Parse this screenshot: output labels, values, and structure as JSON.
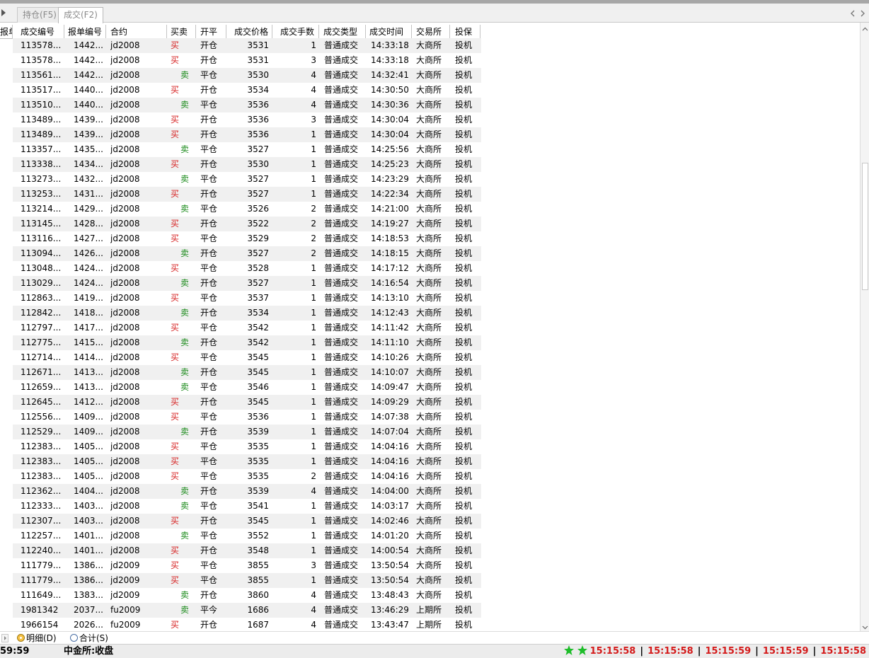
{
  "tabs": [
    {
      "label": "持仓(F5)"
    },
    {
      "label": "成交(F2)"
    }
  ],
  "columns": {
    "left_partial": "报单",
    "trade_id": "成交编号",
    "order_id": "报单编号",
    "instrument": "合约",
    "buy_sell": "买卖",
    "open_close": "开平",
    "price": "成交价格",
    "quantity": "成交手数",
    "trade_type": "成交类型",
    "trade_time": "成交时间",
    "exchange": "交易所",
    "hedge": "投保"
  },
  "rows": [
    {
      "trade_id": "113578...",
      "order_id": "1442...",
      "instrument": "jd2008",
      "side": "buy",
      "buy_sell": "买",
      "open_close": "开仓",
      "price": "3531",
      "quantity": "1",
      "trade_type": "普通成交",
      "trade_time": "14:33:18",
      "exchange": "大商所",
      "hedge": "投机"
    },
    {
      "trade_id": "113578...",
      "order_id": "1442...",
      "instrument": "jd2008",
      "side": "buy",
      "buy_sell": "买",
      "open_close": "开仓",
      "price": "3531",
      "quantity": "3",
      "trade_type": "普通成交",
      "trade_time": "14:33:18",
      "exchange": "大商所",
      "hedge": "投机"
    },
    {
      "trade_id": "113561...",
      "order_id": "1442...",
      "instrument": "jd2008",
      "side": "sell",
      "buy_sell": "卖",
      "open_close": "平仓",
      "price": "3530",
      "quantity": "4",
      "trade_type": "普通成交",
      "trade_time": "14:32:41",
      "exchange": "大商所",
      "hedge": "投机"
    },
    {
      "trade_id": "113517...",
      "order_id": "1440...",
      "instrument": "jd2008",
      "side": "buy",
      "buy_sell": "买",
      "open_close": "开仓",
      "price": "3534",
      "quantity": "4",
      "trade_type": "普通成交",
      "trade_time": "14:30:50",
      "exchange": "大商所",
      "hedge": "投机"
    },
    {
      "trade_id": "113510...",
      "order_id": "1440...",
      "instrument": "jd2008",
      "side": "sell",
      "buy_sell": "卖",
      "open_close": "平仓",
      "price": "3536",
      "quantity": "4",
      "trade_type": "普通成交",
      "trade_time": "14:30:36",
      "exchange": "大商所",
      "hedge": "投机"
    },
    {
      "trade_id": "113489...",
      "order_id": "1439...",
      "instrument": "jd2008",
      "side": "buy",
      "buy_sell": "买",
      "open_close": "开仓",
      "price": "3536",
      "quantity": "3",
      "trade_type": "普通成交",
      "trade_time": "14:30:04",
      "exchange": "大商所",
      "hedge": "投机"
    },
    {
      "trade_id": "113489...",
      "order_id": "1439...",
      "instrument": "jd2008",
      "side": "buy",
      "buy_sell": "买",
      "open_close": "开仓",
      "price": "3536",
      "quantity": "1",
      "trade_type": "普通成交",
      "trade_time": "14:30:04",
      "exchange": "大商所",
      "hedge": "投机"
    },
    {
      "trade_id": "113357...",
      "order_id": "1435...",
      "instrument": "jd2008",
      "side": "sell",
      "buy_sell": "卖",
      "open_close": "平仓",
      "price": "3527",
      "quantity": "1",
      "trade_type": "普通成交",
      "trade_time": "14:25:56",
      "exchange": "大商所",
      "hedge": "投机"
    },
    {
      "trade_id": "113338...",
      "order_id": "1434...",
      "instrument": "jd2008",
      "side": "buy",
      "buy_sell": "买",
      "open_close": "开仓",
      "price": "3530",
      "quantity": "1",
      "trade_type": "普通成交",
      "trade_time": "14:25:23",
      "exchange": "大商所",
      "hedge": "投机"
    },
    {
      "trade_id": "113273...",
      "order_id": "1432...",
      "instrument": "jd2008",
      "side": "sell",
      "buy_sell": "卖",
      "open_close": "平仓",
      "price": "3527",
      "quantity": "1",
      "trade_type": "普通成交",
      "trade_time": "14:23:29",
      "exchange": "大商所",
      "hedge": "投机"
    },
    {
      "trade_id": "113253...",
      "order_id": "1431...",
      "instrument": "jd2008",
      "side": "buy",
      "buy_sell": "买",
      "open_close": "开仓",
      "price": "3527",
      "quantity": "1",
      "trade_type": "普通成交",
      "trade_time": "14:22:34",
      "exchange": "大商所",
      "hedge": "投机"
    },
    {
      "trade_id": "113214...",
      "order_id": "1429...",
      "instrument": "jd2008",
      "side": "sell",
      "buy_sell": "卖",
      "open_close": "平仓",
      "price": "3526",
      "quantity": "2",
      "trade_type": "普通成交",
      "trade_time": "14:21:00",
      "exchange": "大商所",
      "hedge": "投机"
    },
    {
      "trade_id": "113145...",
      "order_id": "1428...",
      "instrument": "jd2008",
      "side": "buy",
      "buy_sell": "买",
      "open_close": "开仓",
      "price": "3522",
      "quantity": "2",
      "trade_type": "普通成交",
      "trade_time": "14:19:27",
      "exchange": "大商所",
      "hedge": "投机"
    },
    {
      "trade_id": "113116...",
      "order_id": "1427...",
      "instrument": "jd2008",
      "side": "buy",
      "buy_sell": "买",
      "open_close": "平仓",
      "price": "3529",
      "quantity": "2",
      "trade_type": "普通成交",
      "trade_time": "14:18:53",
      "exchange": "大商所",
      "hedge": "投机"
    },
    {
      "trade_id": "113094...",
      "order_id": "1426...",
      "instrument": "jd2008",
      "side": "sell",
      "buy_sell": "卖",
      "open_close": "开仓",
      "price": "3527",
      "quantity": "2",
      "trade_type": "普通成交",
      "trade_time": "14:18:15",
      "exchange": "大商所",
      "hedge": "投机"
    },
    {
      "trade_id": "113048...",
      "order_id": "1424...",
      "instrument": "jd2008",
      "side": "buy",
      "buy_sell": "买",
      "open_close": "平仓",
      "price": "3528",
      "quantity": "1",
      "trade_type": "普通成交",
      "trade_time": "14:17:12",
      "exchange": "大商所",
      "hedge": "投机"
    },
    {
      "trade_id": "113029...",
      "order_id": "1424...",
      "instrument": "jd2008",
      "side": "sell",
      "buy_sell": "卖",
      "open_close": "开仓",
      "price": "3527",
      "quantity": "1",
      "trade_type": "普通成交",
      "trade_time": "14:16:54",
      "exchange": "大商所",
      "hedge": "投机"
    },
    {
      "trade_id": "112863...",
      "order_id": "1419...",
      "instrument": "jd2008",
      "side": "buy",
      "buy_sell": "买",
      "open_close": "平仓",
      "price": "3537",
      "quantity": "1",
      "trade_type": "普通成交",
      "trade_time": "14:13:10",
      "exchange": "大商所",
      "hedge": "投机"
    },
    {
      "trade_id": "112842...",
      "order_id": "1418...",
      "instrument": "jd2008",
      "side": "sell",
      "buy_sell": "卖",
      "open_close": "开仓",
      "price": "3534",
      "quantity": "1",
      "trade_type": "普通成交",
      "trade_time": "14:12:43",
      "exchange": "大商所",
      "hedge": "投机"
    },
    {
      "trade_id": "112797...",
      "order_id": "1417...",
      "instrument": "jd2008",
      "side": "buy",
      "buy_sell": "买",
      "open_close": "平仓",
      "price": "3542",
      "quantity": "1",
      "trade_type": "普通成交",
      "trade_time": "14:11:42",
      "exchange": "大商所",
      "hedge": "投机"
    },
    {
      "trade_id": "112775...",
      "order_id": "1415...",
      "instrument": "jd2008",
      "side": "sell",
      "buy_sell": "卖",
      "open_close": "开仓",
      "price": "3542",
      "quantity": "1",
      "trade_type": "普通成交",
      "trade_time": "14:11:10",
      "exchange": "大商所",
      "hedge": "投机"
    },
    {
      "trade_id": "112714...",
      "order_id": "1414...",
      "instrument": "jd2008",
      "side": "buy",
      "buy_sell": "买",
      "open_close": "平仓",
      "price": "3545",
      "quantity": "1",
      "trade_type": "普通成交",
      "trade_time": "14:10:26",
      "exchange": "大商所",
      "hedge": "投机"
    },
    {
      "trade_id": "112671...",
      "order_id": "1413...",
      "instrument": "jd2008",
      "side": "sell",
      "buy_sell": "卖",
      "open_close": "开仓",
      "price": "3545",
      "quantity": "1",
      "trade_type": "普通成交",
      "trade_time": "14:10:07",
      "exchange": "大商所",
      "hedge": "投机"
    },
    {
      "trade_id": "112659...",
      "order_id": "1413...",
      "instrument": "jd2008",
      "side": "sell",
      "buy_sell": "卖",
      "open_close": "平仓",
      "price": "3546",
      "quantity": "1",
      "trade_type": "普通成交",
      "trade_time": "14:09:47",
      "exchange": "大商所",
      "hedge": "投机"
    },
    {
      "trade_id": "112645...",
      "order_id": "1412...",
      "instrument": "jd2008",
      "side": "buy",
      "buy_sell": "买",
      "open_close": "开仓",
      "price": "3545",
      "quantity": "1",
      "trade_type": "普通成交",
      "trade_time": "14:09:29",
      "exchange": "大商所",
      "hedge": "投机"
    },
    {
      "trade_id": "112556...",
      "order_id": "1409...",
      "instrument": "jd2008",
      "side": "buy",
      "buy_sell": "买",
      "open_close": "平仓",
      "price": "3536",
      "quantity": "1",
      "trade_type": "普通成交",
      "trade_time": "14:07:38",
      "exchange": "大商所",
      "hedge": "投机"
    },
    {
      "trade_id": "112529...",
      "order_id": "1409...",
      "instrument": "jd2008",
      "side": "sell",
      "buy_sell": "卖",
      "open_close": "开仓",
      "price": "3539",
      "quantity": "1",
      "trade_type": "普通成交",
      "trade_time": "14:07:04",
      "exchange": "大商所",
      "hedge": "投机"
    },
    {
      "trade_id": "112383...",
      "order_id": "1405...",
      "instrument": "jd2008",
      "side": "buy",
      "buy_sell": "买",
      "open_close": "平仓",
      "price": "3535",
      "quantity": "1",
      "trade_type": "普通成交",
      "trade_time": "14:04:16",
      "exchange": "大商所",
      "hedge": "投机"
    },
    {
      "trade_id": "112383...",
      "order_id": "1405...",
      "instrument": "jd2008",
      "side": "buy",
      "buy_sell": "买",
      "open_close": "平仓",
      "price": "3535",
      "quantity": "1",
      "trade_type": "普通成交",
      "trade_time": "14:04:16",
      "exchange": "大商所",
      "hedge": "投机"
    },
    {
      "trade_id": "112383...",
      "order_id": "1405...",
      "instrument": "jd2008",
      "side": "buy",
      "buy_sell": "买",
      "open_close": "平仓",
      "price": "3535",
      "quantity": "2",
      "trade_type": "普通成交",
      "trade_time": "14:04:16",
      "exchange": "大商所",
      "hedge": "投机"
    },
    {
      "trade_id": "112362...",
      "order_id": "1404...",
      "instrument": "jd2008",
      "side": "sell",
      "buy_sell": "卖",
      "open_close": "开仓",
      "price": "3539",
      "quantity": "4",
      "trade_type": "普通成交",
      "trade_time": "14:04:00",
      "exchange": "大商所",
      "hedge": "投机"
    },
    {
      "trade_id": "112333...",
      "order_id": "1403...",
      "instrument": "jd2008",
      "side": "sell",
      "buy_sell": "卖",
      "open_close": "平仓",
      "price": "3541",
      "quantity": "1",
      "trade_type": "普通成交",
      "trade_time": "14:03:17",
      "exchange": "大商所",
      "hedge": "投机"
    },
    {
      "trade_id": "112307...",
      "order_id": "1403...",
      "instrument": "jd2008",
      "side": "buy",
      "buy_sell": "买",
      "open_close": "开仓",
      "price": "3545",
      "quantity": "1",
      "trade_type": "普通成交",
      "trade_time": "14:02:46",
      "exchange": "大商所",
      "hedge": "投机"
    },
    {
      "trade_id": "112257...",
      "order_id": "1401...",
      "instrument": "jd2008",
      "side": "sell",
      "buy_sell": "卖",
      "open_close": "平仓",
      "price": "3552",
      "quantity": "1",
      "trade_type": "普通成交",
      "trade_time": "14:01:20",
      "exchange": "大商所",
      "hedge": "投机"
    },
    {
      "trade_id": "112240...",
      "order_id": "1401...",
      "instrument": "jd2008",
      "side": "buy",
      "buy_sell": "买",
      "open_close": "开仓",
      "price": "3548",
      "quantity": "1",
      "trade_type": "普通成交",
      "trade_time": "14:00:54",
      "exchange": "大商所",
      "hedge": "投机"
    },
    {
      "trade_id": "111779...",
      "order_id": "1386...",
      "instrument": "jd2009",
      "side": "buy",
      "buy_sell": "买",
      "open_close": "平仓",
      "price": "3855",
      "quantity": "3",
      "trade_type": "普通成交",
      "trade_time": "13:50:54",
      "exchange": "大商所",
      "hedge": "投机"
    },
    {
      "trade_id": "111779...",
      "order_id": "1386...",
      "instrument": "jd2009",
      "side": "buy",
      "buy_sell": "买",
      "open_close": "平仓",
      "price": "3855",
      "quantity": "1",
      "trade_type": "普通成交",
      "trade_time": "13:50:54",
      "exchange": "大商所",
      "hedge": "投机"
    },
    {
      "trade_id": "111649...",
      "order_id": "1383...",
      "instrument": "jd2009",
      "side": "sell",
      "buy_sell": "卖",
      "open_close": "开仓",
      "price": "3860",
      "quantity": "4",
      "trade_type": "普通成交",
      "trade_time": "13:48:43",
      "exchange": "大商所",
      "hedge": "投机"
    },
    {
      "trade_id": "1981342",
      "order_id": "2037...",
      "instrument": "fu2009",
      "side": "sell",
      "buy_sell": "卖",
      "open_close": "平今",
      "price": "1686",
      "quantity": "4",
      "trade_type": "普通成交",
      "trade_time": "13:46:29",
      "exchange": "上期所",
      "hedge": "投机"
    },
    {
      "trade_id": "1966154",
      "order_id": "2026...",
      "instrument": "fu2009",
      "side": "buy",
      "buy_sell": "买",
      "open_close": "开仓",
      "price": "1687",
      "quantity": "4",
      "trade_type": "普通成交",
      "trade_time": "13:43:47",
      "exchange": "上期所",
      "hedge": "投机"
    }
  ],
  "view_options": {
    "detail_label": "明细(D)",
    "total_label": "合计(S)",
    "selected": "detail"
  },
  "status": {
    "left_time": "59:59",
    "cffex_status": "中金所:收盘",
    "clocks": [
      "15:15:58",
      "15:15:58",
      "15:15:59",
      "15:15:59",
      "15:15:58"
    ]
  },
  "colors": {
    "buy": "#d62020",
    "sell": "#1a8a1a",
    "clock": "#d41a1a",
    "star": "#1ebd2a"
  },
  "icons": [
    "left-arrow-icon",
    "tab-prev-icon",
    "tab-next-icon",
    "scroll-up-icon",
    "scroll-down-icon",
    "star-icon"
  ]
}
